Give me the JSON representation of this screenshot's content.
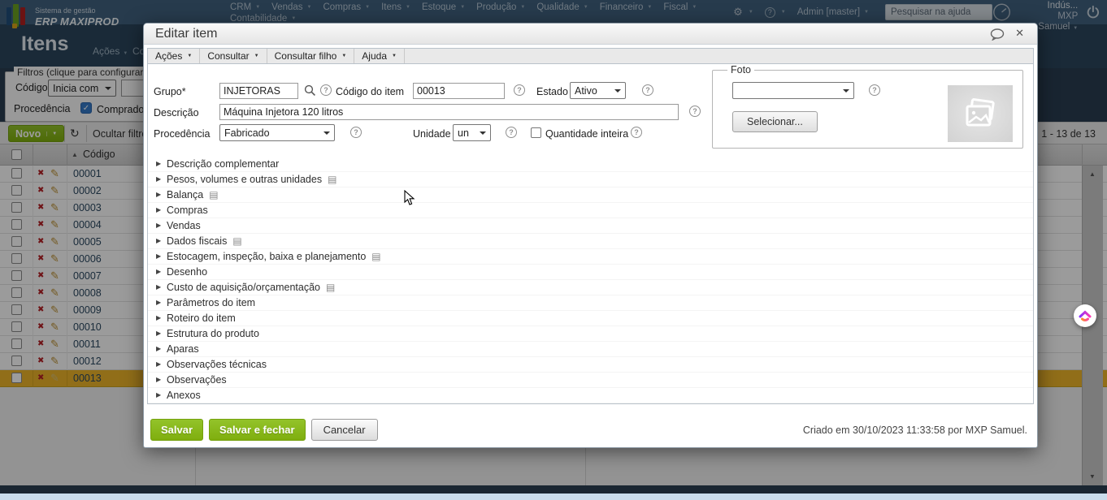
{
  "topnav": {
    "brand_line1": "Sistema de gestão",
    "brand_line2": "ERP MAXIPROD",
    "menus": [
      "CRM",
      "Vendas",
      "Compras",
      "Itens",
      "Estoque",
      "Produção",
      "Qualidade",
      "Financeiro",
      "Fiscal",
      "Contabilidade"
    ],
    "admin_label": "Admin [master]",
    "search_placeholder": "Pesquisar na ajuda",
    "company": "Horita Indús...",
    "user": "MXP Samuel"
  },
  "page": {
    "title": "Itens",
    "menu_acoes": "Ações",
    "menu_consultar": "Consultar",
    "filters": {
      "legend": "Filtros (clique para configurar)",
      "codigo_label": "Código",
      "codigo_operator": "Inicia com",
      "procedencia_label": "Procedência",
      "comprado_label": "Comprado"
    },
    "toolbar": {
      "new_button": "Novo",
      "hide_filters": "Ocultar filtros",
      "pagination": "1 - 13 de 13"
    },
    "table": {
      "code_header": "Código",
      "codes": [
        "00001",
        "00002",
        "00003",
        "00004",
        "00005",
        "00006",
        "00007",
        "00008",
        "00009",
        "00010",
        "00011",
        "00012",
        "00013"
      ],
      "selected_code": "00013"
    }
  },
  "modal": {
    "title": "Editar item",
    "menus": [
      "Ações",
      "Consultar",
      "Consultar filho",
      "Ajuda"
    ],
    "form": {
      "grupo_label": "Grupo*",
      "grupo_value": "INJETORAS",
      "codigo_label": "Código do item",
      "codigo_value": "00013",
      "estado_label": "Estado",
      "estado_value": "Ativo",
      "descricao_label": "Descrição",
      "descricao_value": "Máquina Injetora 120 litros",
      "procedencia_label": "Procedência",
      "procedencia_value": "Fabricado",
      "unidade_label": "Unidade",
      "unidade_value": "un",
      "quantidade_inteira_label": "Quantidade inteira",
      "foto_legend": "Foto",
      "foto_select_value": "",
      "selecionar_button": "Selecionar..."
    },
    "sections": [
      {
        "label": "Descrição complementar",
        "doc": false
      },
      {
        "label": "Pesos, volumes e outras unidades",
        "doc": true
      },
      {
        "label": "Balança",
        "doc": true
      },
      {
        "label": "Compras",
        "doc": false
      },
      {
        "label": "Vendas",
        "doc": false
      },
      {
        "label": "Dados fiscais",
        "doc": true
      },
      {
        "label": "Estocagem, inspeção, baixa e planejamento",
        "doc": true
      },
      {
        "label": "Desenho",
        "doc": false
      },
      {
        "label": "Custo de aquisição/orçamentação",
        "doc": true
      },
      {
        "label": "Parâmetros do item",
        "doc": false
      },
      {
        "label": "Roteiro do item",
        "doc": false
      },
      {
        "label": "Estrutura do produto",
        "doc": false
      },
      {
        "label": "Aparas",
        "doc": false
      },
      {
        "label": "Observações técnicas",
        "doc": false
      },
      {
        "label": "Observações",
        "doc": false
      },
      {
        "label": "Anexos",
        "doc": false
      }
    ],
    "footer": {
      "save": "Salvar",
      "save_and_close": "Salvar e fechar",
      "cancel": "Cancelar",
      "created_text": "Criado em 30/10/2023 11:33:58 por MXP Samuel."
    }
  },
  "icons": {
    "caret-down": "▼",
    "sort-asc": "▲",
    "expand-arrow": "▶",
    "doc-sheet": "▤",
    "delete-x": "✖",
    "edit-pencil": "✎",
    "refresh": "↻",
    "gear": "⚙",
    "help-q": "?",
    "check": "✓",
    "close-x": "✕"
  },
  "colors": {
    "accent_green": "#85b113",
    "selected_row": "#edb429",
    "nav_bg": "#41617e",
    "header_bg": "#2c455c"
  }
}
